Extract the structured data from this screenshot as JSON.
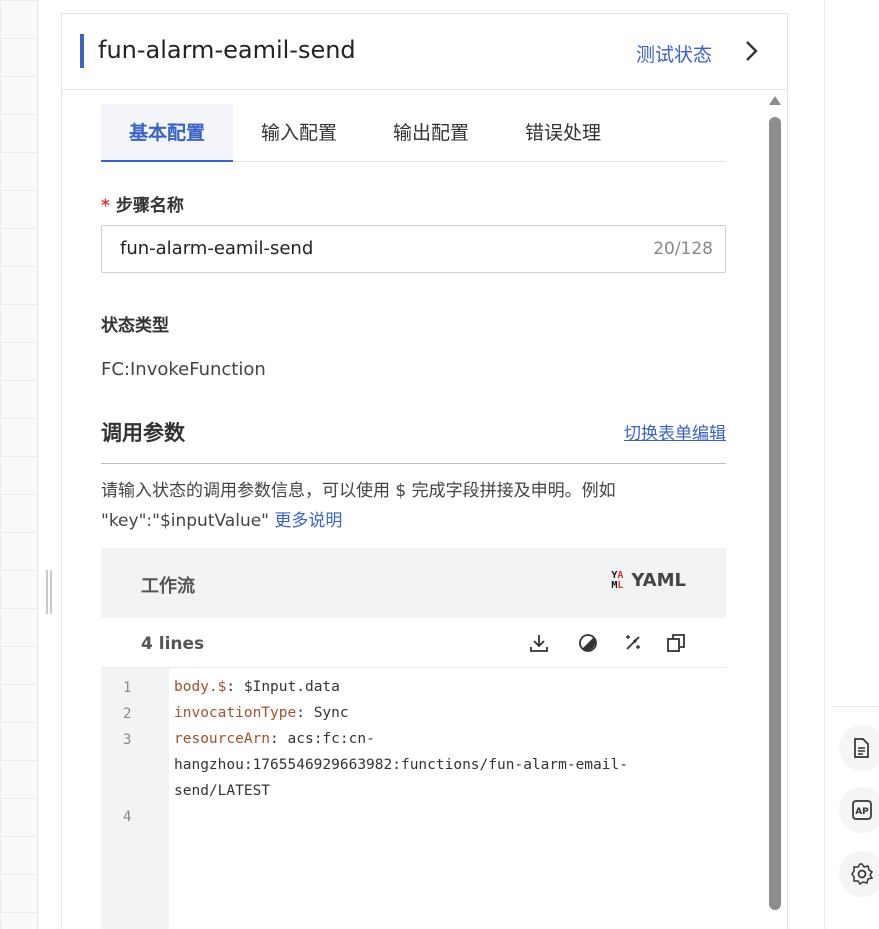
{
  "header": {
    "title": "fun-alarm-eamil-send",
    "test_link": "测试状态"
  },
  "tabs": [
    {
      "label": "基本配置",
      "active": true
    },
    {
      "label": "输入配置",
      "active": false
    },
    {
      "label": "输出配置",
      "active": false
    },
    {
      "label": "错误处理",
      "active": false
    }
  ],
  "form": {
    "step_name_required": "*",
    "step_name_label": "步骤名称",
    "step_name_value": "fun-alarm-eamil-send",
    "step_name_count": "20/128",
    "state_type_label": "状态类型",
    "state_type_value": "FC:InvokeFunction"
  },
  "params": {
    "title": "调用参数",
    "switch_link": "切换表单编辑",
    "hint_text": "请输入状态的调用参数信息，可以使用 $ 完成字段拼接及申明。例如 \"key\":\"$inputValue\"",
    "more_link": "更多说明"
  },
  "editor": {
    "title": "工作流",
    "format": "YAML",
    "lines_label": "4 lines",
    "line_numbers": [
      "1",
      "2",
      "3",
      "4"
    ],
    "lines": [
      {
        "key": "body.$",
        "value": "$Input.data"
      },
      {
        "key": "invocationType",
        "value": "Sync"
      },
      {
        "key": "resourceArn",
        "value": "acs:fc:cn-",
        "wrap1": "hangzhou:1765546929663982:functions/fun-alarm-email-",
        "wrap2": "send/LATEST"
      }
    ],
    "tools": [
      "download-icon",
      "theme-icon",
      "magic-wand-icon",
      "copy-icon"
    ]
  },
  "side_buttons": [
    "document-icon",
    "api-icon",
    "settings-icon"
  ],
  "colors": {
    "accent": "#3a63c4",
    "required": "#d9363e",
    "yaml_key": "#a0522d"
  }
}
